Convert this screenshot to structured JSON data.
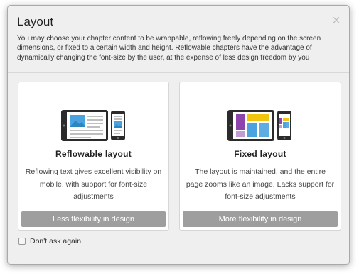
{
  "dialog": {
    "title": "Layout",
    "close_glyph": "×",
    "description": "You may choose your chapter content to be wrappable, reflowing freely depending on the screen dimensions, or fixed to a certain width and height. Reflowable chapters have the advantage of dynamically changing the font-size by the user, at the expense of less design freedom by you"
  },
  "options": [
    {
      "title": "Reflowable layout",
      "description": "Reflowing text gives excellent visibility on mobile, with support for font-size adjustments",
      "button_label": "Less flexibility in design",
      "icon": "tablet-phone-reflowable-icon"
    },
    {
      "title": "Fixed layout",
      "description": "The layout is maintained, and the entire page zooms like an image. Lacks support for font-size adjustments",
      "button_label": "More flexibility in design",
      "icon": "tablet-phone-fixed-icon"
    }
  ],
  "footer": {
    "dont_ask_label": "Don't ask again",
    "dont_ask_checked": false
  },
  "colors": {
    "dialog_bg": "#efefef",
    "button_bg": "#9e9e9e",
    "device_dark": "#2b2b2b",
    "accent_blue": "#4aa3df",
    "accent_purple": "#8e44ad",
    "accent_yellow": "#f1c40f"
  }
}
